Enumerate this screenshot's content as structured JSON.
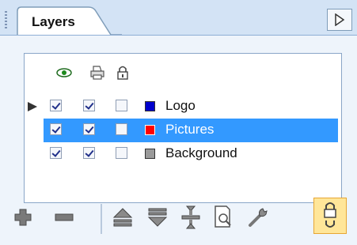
{
  "panel": {
    "tab_title": "Layers",
    "menu_icon": "triangle-right-icon"
  },
  "header_icons": [
    "eye-icon",
    "printer-icon",
    "padlock-icon"
  ],
  "layers": [
    {
      "name": "Logo",
      "visible": true,
      "printable": true,
      "locked": false,
      "color": "#0000cc",
      "selected": false,
      "active": true
    },
    {
      "name": "Pictures",
      "visible": true,
      "printable": true,
      "locked": false,
      "color": "#ff0000",
      "selected": true,
      "active": false
    },
    {
      "name": "Background",
      "visible": true,
      "printable": true,
      "locked": false,
      "color": "#9a9a9a",
      "selected": false,
      "active": false
    }
  ],
  "toolbar": [
    {
      "icon": "add-layer-icon"
    },
    {
      "icon": "remove-layer-icon"
    },
    {
      "icon": "move-layer-up-icon"
    },
    {
      "icon": "move-layer-down-icon"
    },
    {
      "icon": "merge-layers-icon"
    },
    {
      "icon": "layer-properties-icon"
    },
    {
      "icon": "layer-settings-icon"
    },
    {
      "icon": "lock-layer-icon",
      "active": true
    }
  ],
  "colors": {
    "panel_bg": "#d3e3f5",
    "selection": "#3399ff",
    "toolbar_active_bg": "#ffe699"
  }
}
